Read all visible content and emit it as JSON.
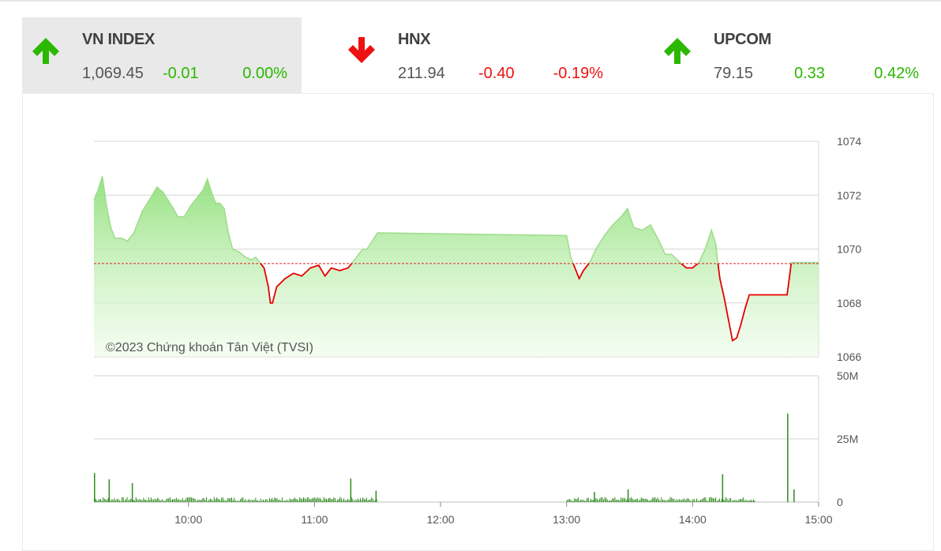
{
  "tickers": [
    {
      "name": "VN INDEX",
      "value": "1,069.45",
      "change": "-0.01",
      "percent": "0.00%",
      "direction": "up",
      "active": true
    },
    {
      "name": "HNX",
      "value": "211.94",
      "change": "-0.40",
      "percent": "-0.19%",
      "direction": "down",
      "active": false
    },
    {
      "name": "UPCOM",
      "value": "79.15",
      "change": "0.33",
      "percent": "0.42%",
      "direction": "up",
      "active": false
    }
  ],
  "colors": {
    "up": "#2bb800",
    "down": "#ee1111",
    "area_fill": "#a8e89a",
    "line_red": "#e60000",
    "volume": "#2e8b1e"
  },
  "chart_data": {
    "type": "area",
    "copyright": "©2023 Chứng khoán Tân Việt (TVSI)",
    "reference_value": 1069.46,
    "x_ticks": [
      "10:00",
      "11:00",
      "12:00",
      "13:00",
      "14:00",
      "15:00"
    ],
    "x_range": [
      "09:15",
      "15:00"
    ],
    "price_axis": {
      "min": 1066,
      "max": 1074,
      "ticks": [
        "1074",
        "1072",
        "1070",
        "1068",
        "1066"
      ]
    },
    "price_series": [
      [
        "09:15",
        1071.8
      ],
      [
        "09:17",
        1072.2
      ],
      [
        "09:19",
        1072.7
      ],
      [
        "09:21",
        1071.6
      ],
      [
        "09:23",
        1070.8
      ],
      [
        "09:25",
        1070.4
      ],
      [
        "09:28",
        1070.4
      ],
      [
        "09:31",
        1070.3
      ],
      [
        "09:34",
        1070.6
      ],
      [
        "09:38",
        1071.4
      ],
      [
        "09:42",
        1071.9
      ],
      [
        "09:45",
        1072.3
      ],
      [
        "09:48",
        1072.1
      ],
      [
        "09:52",
        1071.6
      ],
      [
        "09:55",
        1071.2
      ],
      [
        "09:58",
        1071.2
      ],
      [
        "10:01",
        1071.6
      ],
      [
        "10:04",
        1071.9
      ],
      [
        "10:07",
        1072.2
      ],
      [
        "10:09",
        1072.6
      ],
      [
        "10:11",
        1072.1
      ],
      [
        "10:13",
        1071.7
      ],
      [
        "10:15",
        1071.7
      ],
      [
        "10:17",
        1071.5
      ],
      [
        "10:19",
        1070.6
      ],
      [
        "10:21",
        1070.0
      ],
      [
        "10:24",
        1069.9
      ],
      [
        "10:27",
        1069.7
      ],
      [
        "10:30",
        1069.6
      ],
      [
        "10:32",
        1069.7
      ],
      [
        "10:34",
        1069.5
      ],
      [
        "10:36",
        1069.3
      ],
      [
        "10:38",
        1068.6
      ],
      [
        "10:39",
        1068.0
      ],
      [
        "10:40",
        1068.0
      ],
      [
        "10:42",
        1068.6
      ],
      [
        "10:46",
        1068.9
      ],
      [
        "10:50",
        1069.1
      ],
      [
        "10:54",
        1069.0
      ],
      [
        "10:58",
        1069.3
      ],
      [
        "11:02",
        1069.4
      ],
      [
        "11:05",
        1069.0
      ],
      [
        "11:08",
        1069.3
      ],
      [
        "11:12",
        1069.2
      ],
      [
        "11:16",
        1069.3
      ],
      [
        "11:20",
        1069.7
      ],
      [
        "11:23",
        1070.0
      ],
      [
        "11:25",
        1070.0
      ],
      [
        "11:30",
        1070.6
      ],
      [
        "13:00",
        1070.5
      ],
      [
        "13:02",
        1069.7
      ],
      [
        "13:04",
        1069.3
      ],
      [
        "13:06",
        1068.9
      ],
      [
        "13:08",
        1069.2
      ],
      [
        "13:11",
        1069.5
      ],
      [
        "13:14",
        1070.0
      ],
      [
        "13:18",
        1070.5
      ],
      [
        "13:22",
        1070.9
      ],
      [
        "13:26",
        1071.2
      ],
      [
        "13:29",
        1071.5
      ],
      [
        "13:32",
        1070.8
      ],
      [
        "13:36",
        1070.7
      ],
      [
        "13:40",
        1070.9
      ],
      [
        "13:44",
        1070.3
      ],
      [
        "13:47",
        1069.8
      ],
      [
        "13:50",
        1069.8
      ],
      [
        "13:54",
        1069.5
      ],
      [
        "13:57",
        1069.3
      ],
      [
        "14:00",
        1069.3
      ],
      [
        "14:03",
        1069.5
      ],
      [
        "14:06",
        1070.0
      ],
      [
        "14:09",
        1070.7
      ],
      [
        "14:11",
        1070.2
      ],
      [
        "14:12",
        1069.5
      ],
      [
        "14:13",
        1068.9
      ],
      [
        "14:15",
        1068.2
      ],
      [
        "14:17",
        1067.4
      ],
      [
        "14:19",
        1066.6
      ],
      [
        "14:21",
        1066.7
      ],
      [
        "14:23",
        1067.2
      ],
      [
        "14:25",
        1067.8
      ],
      [
        "14:27",
        1068.3
      ],
      [
        "14:35",
        1068.3
      ],
      [
        "14:45",
        1068.3
      ],
      [
        "14:47",
        1069.5
      ],
      [
        "15:00",
        1069.5
      ]
    ],
    "volume_axis": {
      "min": 0,
      "max": 50,
      "ticks": [
        "50M",
        "25M",
        "0"
      ]
    },
    "volume_spikes": [
      [
        "09:15",
        11.5
      ],
      [
        "09:22",
        9.0
      ],
      [
        "09:33",
        7.5
      ],
      [
        "11:17",
        9.3
      ],
      [
        "11:29",
        4.5
      ],
      [
        "13:13",
        4.0
      ],
      [
        "13:29",
        5.0
      ],
      [
        "14:14",
        11.0
      ],
      [
        "14:45",
        35.0
      ],
      [
        "14:48",
        5.0
      ]
    ]
  }
}
